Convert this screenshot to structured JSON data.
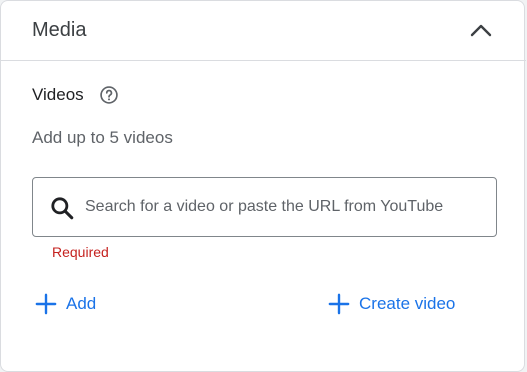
{
  "panel": {
    "title": "Media"
  },
  "videos": {
    "title": "Videos",
    "hint": "Add up to 5 videos",
    "search": {
      "placeholder": "Search for a video or paste the URL from YouTube",
      "value": ""
    },
    "error": "Required",
    "add_label": "Add",
    "create_label": "Create video"
  },
  "icons": {
    "collapse": "chevron-up-icon",
    "help": "help-circle-icon",
    "search": "search-icon",
    "add": "plus-icon"
  },
  "colors": {
    "accent": "#1a73e8",
    "error": "#c5221f",
    "border": "#dadce0"
  }
}
